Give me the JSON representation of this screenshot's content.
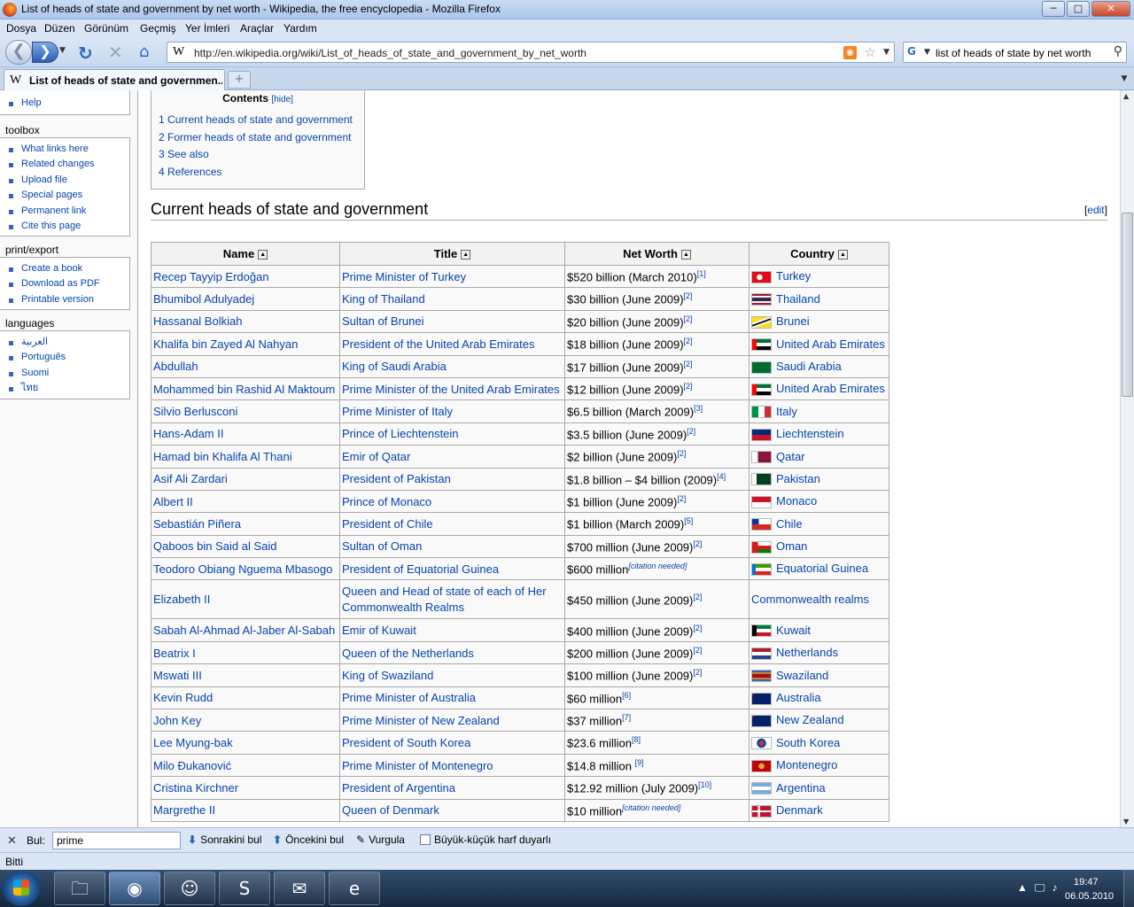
{
  "window": {
    "title": "List of heads of state and government by net worth - Wikipedia, the free encyclopedia - Mozilla Firefox",
    "minimize": "─",
    "maximize": "□",
    "close": "✕"
  },
  "menu": [
    "Dosya",
    "Düzen",
    "Görünüm",
    "Geçmiş",
    "Yer İmleri",
    "Araçlar",
    "Yardım"
  ],
  "nav": {
    "url": "http://en.wikipedia.org/wiki/List_of_heads_of_state_and_government_by_net_worth",
    "search_value": "list of heads of state by net worth"
  },
  "tab": {
    "label": "List of heads of state and governmen...",
    "new_tab": "+"
  },
  "sidebar": {
    "top_items": [
      "Help"
    ],
    "toolbox_title": "toolbox",
    "toolbox": [
      "What links here",
      "Related changes",
      "Upload file",
      "Special pages",
      "Permanent link",
      "Cite this page"
    ],
    "print_title": "print/export",
    "print": [
      "Create a book",
      "Download as PDF",
      "Printable version"
    ],
    "languages_title": "languages",
    "languages": [
      "العربية",
      "Português",
      "Suomi",
      "ไทย"
    ]
  },
  "toc": {
    "title": "Contents",
    "hide": "hide",
    "items": [
      {
        "num": "1",
        "text": "Current heads of state and government"
      },
      {
        "num": "2",
        "text": "Former heads of state and government"
      },
      {
        "num": "3",
        "text": "See also"
      },
      {
        "num": "4",
        "text": "References"
      }
    ]
  },
  "section": {
    "title": "Current heads of state and government",
    "edit": "edit"
  },
  "table": {
    "headers": [
      "Name",
      "Title",
      "Net Worth",
      "Country"
    ],
    "rows": [
      {
        "name": "Recep Tayyip Erdoğan",
        "title": "Prime Minister of Turkey",
        "worth": "$520 billion (March 2010)",
        "ref": "[1]",
        "country": "Turkey",
        "flag": "turkey"
      },
      {
        "name": "Bhumibol Adulyadej",
        "title": "King of Thailand",
        "worth": "$30 billion (June 2009)",
        "ref": "[2]",
        "country": "Thailand",
        "flag": "thailand"
      },
      {
        "name": "Hassanal Bolkiah",
        "title": "Sultan of Brunei",
        "worth": "$20 billion (June 2009)",
        "ref": "[2]",
        "country": "Brunei",
        "flag": "brunei"
      },
      {
        "name": "Khalifa bin Zayed Al Nahyan",
        "title": "President of the United Arab Emirates",
        "worth": "$18 billion (June 2009)",
        "ref": "[2]",
        "country": "United Arab Emirates",
        "flag": "uae"
      },
      {
        "name": "Abdullah",
        "title": "King of Saudi Arabia",
        "worth": "$17 billion (June 2009)",
        "ref": "[2]",
        "country": "Saudi Arabia",
        "flag": "saudi"
      },
      {
        "name": "Mohammed bin Rashid Al Maktoum",
        "title": "Prime Minister of the United Arab Emirates",
        "worth": "$12 billion (June 2009)",
        "ref": "[2]",
        "country": "United Arab Emirates",
        "flag": "uae"
      },
      {
        "name": "Silvio Berlusconi",
        "title": "Prime Minister of Italy",
        "worth": "$6.5 billion (March 2009)",
        "ref": "[3]",
        "country": "Italy",
        "flag": "italy"
      },
      {
        "name": "Hans-Adam II",
        "title": "Prince of Liechtenstein",
        "worth": "$3.5 billion (June 2009)",
        "ref": "[2]",
        "country": "Liechtenstein",
        "flag": "liechtenstein"
      },
      {
        "name": "Hamad bin Khalifa Al Thani",
        "title": "Emir of Qatar",
        "worth": "$2 billion (June 2009)",
        "ref": "[2]",
        "country": "Qatar",
        "flag": "qatar"
      },
      {
        "name": "Asif Ali Zardari",
        "title": "President of Pakistan",
        "worth": "$1.8 billion – $4 billion (2009)",
        "ref": "[4]",
        "country": "Pakistan",
        "flag": "pakistan"
      },
      {
        "name": "Albert II",
        "title": "Prince of Monaco",
        "worth": "$1 billion (June 2009)",
        "ref": "[2]",
        "country": "Monaco",
        "flag": "monaco"
      },
      {
        "name": "Sebastián Piñera",
        "title": "President of Chile",
        "worth": "$1 billion (March 2009)",
        "ref": "[5]",
        "country": "Chile",
        "flag": "chile"
      },
      {
        "name": "Qaboos bin Said al Said",
        "title": "Sultan of Oman",
        "worth": "$700 million (June 2009)",
        "ref": "[2]",
        "country": "Oman",
        "flag": "oman"
      },
      {
        "name": "Teodoro Obiang Nguema Mbasogo",
        "title": "President of Equatorial Guinea",
        "worth": "$600 million",
        "cit": "[citation needed]",
        "country": "Equatorial Guinea",
        "flag": "eqguinea"
      },
      {
        "name": "Elizabeth II",
        "title": "Queen and Head of state of each of Her Commonwealth Realms",
        "worth": "$450 million (June 2009)",
        "ref": "[2]",
        "country": "Commonwealth realms",
        "flag": ""
      },
      {
        "name": "Sabah Al-Ahmad Al-Jaber Al-Sabah",
        "title": "Emir of Kuwait",
        "worth": "$400 million (June 2009)",
        "ref": "[2]",
        "country": "Kuwait",
        "flag": "kuwait"
      },
      {
        "name": "Beatrix I",
        "title": "Queen of the Netherlands",
        "worth": "$200 million (June 2009)",
        "ref": "[2]",
        "country": "Netherlands",
        "flag": "netherlands"
      },
      {
        "name": "Mswati III",
        "title": "King of Swaziland",
        "worth": "$100 million (June 2009)",
        "ref": "[2]",
        "country": "Swaziland",
        "flag": "swaziland"
      },
      {
        "name": "Kevin Rudd",
        "title": "Prime Minister of Australia",
        "worth": "$60 million",
        "ref": "[6]",
        "country": "Australia",
        "flag": "australia"
      },
      {
        "name": "John Key",
        "title": "Prime Minister of New Zealand",
        "worth": "$37 million",
        "ref": "[7]",
        "country": "New Zealand",
        "flag": "nz"
      },
      {
        "name": "Lee Myung-bak",
        "title": "President of South Korea",
        "worth": "$23.6 million",
        "ref": "[8]",
        "country": "South Korea",
        "flag": "korea"
      },
      {
        "name": "Milo Đukanović",
        "title": "Prime Minister of Montenegro",
        "worth": "$14.8 million ",
        "ref": "[9]",
        "country": "Montenegro",
        "flag": "montenegro"
      },
      {
        "name": "Cristina Kirchner",
        "title": "President of Argentina",
        "worth": "$12.92 million (July 2009)",
        "ref": "[10]",
        "country": "Argentina",
        "flag": "argentina"
      },
      {
        "name": "Margrethe II",
        "title": "Queen of Denmark",
        "worth": "$10 million",
        "cit": "[citation needed]",
        "country": "Denmark",
        "flag": "denmark"
      }
    ]
  },
  "findbar": {
    "label": "Bul:",
    "value": "prime",
    "next": "Sonrakini bul",
    "prev": "Öncekini bul",
    "highlight": "Vurgula",
    "match_case": "Büyük-küçük harf duyarlı"
  },
  "status": "Bitti",
  "taskbar": {
    "time": "19:47",
    "date": "06.05.2010"
  }
}
